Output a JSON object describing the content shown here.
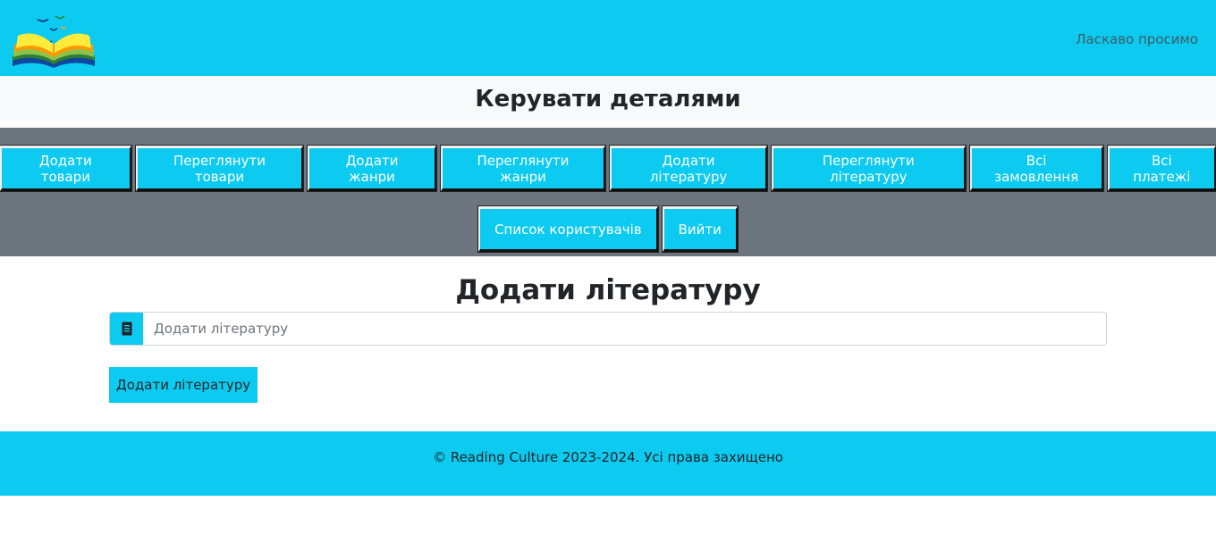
{
  "header": {
    "logo_icon": "open-book-logo",
    "welcome_text": "Ласкаво просимо"
  },
  "manage": {
    "title": "Керувати деталями"
  },
  "menu": {
    "row1": [
      {
        "label": "Додати товари"
      },
      {
        "label": "Переглянути товари"
      },
      {
        "label": "Додати жанри"
      },
      {
        "label": "Переглянути жанри"
      },
      {
        "label": "Додати літературу"
      },
      {
        "label": "Переглянути літературу"
      },
      {
        "label": "Всі замовлення"
      },
      {
        "label": "Всі платежі"
      }
    ],
    "row2": [
      {
        "label": "Список користувачів"
      },
      {
        "label": "Вийти"
      }
    ]
  },
  "form": {
    "title": "Додати літературу",
    "input_icon": "document-icon",
    "input_placeholder": "Додати літературу",
    "input_value": "",
    "submit_label": "Додати літературу"
  },
  "footer": {
    "text": "© Reading Culture 2023-2024. Усі права захищено"
  },
  "colors": {
    "accent": "#0dcaf0",
    "menu_bg": "#6c757d",
    "light_bg": "#f8f9fa"
  }
}
